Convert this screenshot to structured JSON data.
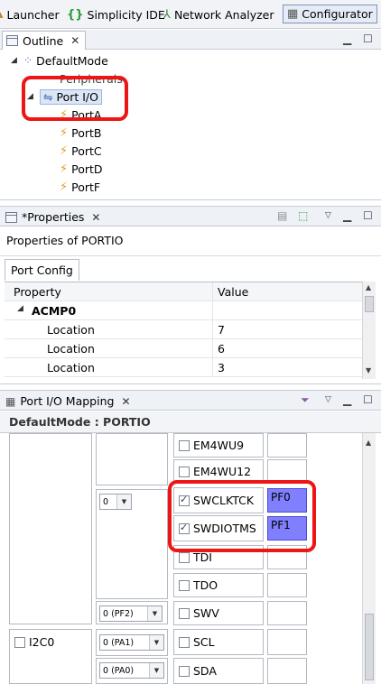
{
  "perspectives": {
    "launcher": "Launcher",
    "simplicity": "Simplicity IDE",
    "network": "Network Analyzer",
    "configurator": "Configurator"
  },
  "outline": {
    "tab_title": "Outline",
    "root": "DefaultMode",
    "peripherals": "Peripherals",
    "portio": "Port I/O",
    "ports": [
      "PortA",
      "PortB",
      "PortC",
      "PortD",
      "PortF"
    ]
  },
  "properties": {
    "tab_title": "*Properties",
    "header": "Properties of PORTIO",
    "subtab": "Port Config",
    "columns": [
      "Property",
      "Value"
    ],
    "group": "ACMP0",
    "rows": [
      {
        "name": "Location",
        "value": "7"
      },
      {
        "name": "Location",
        "value": "6"
      },
      {
        "name": "Location",
        "value": "3"
      }
    ]
  },
  "mapping": {
    "tab_title": "Port I/O Mapping",
    "header": "DefaultMode : PORTIO",
    "signals": {
      "em4wu9": "EM4WU9",
      "em4wu12": "EM4WU12",
      "swclktck": "SWCLKTCK",
      "swdiotms": "SWDIOTMS",
      "tdi": "TDI",
      "tdo": "TDO",
      "swv": "SWV",
      "scl": "SCL",
      "sda": "SDA"
    },
    "pins": {
      "swclktck": "PF0",
      "swdiotms": "PF1"
    },
    "dropdowns": {
      "dbg_loc": "0",
      "swv_loc": "0 (PF2)",
      "scl_loc": "0 (PA1)",
      "sda_loc": "0 (PA0)"
    },
    "peripheral_i2c": "I2C0"
  },
  "colors": {
    "highlight": "#ee1515",
    "pin_fill": "#8080ff"
  }
}
